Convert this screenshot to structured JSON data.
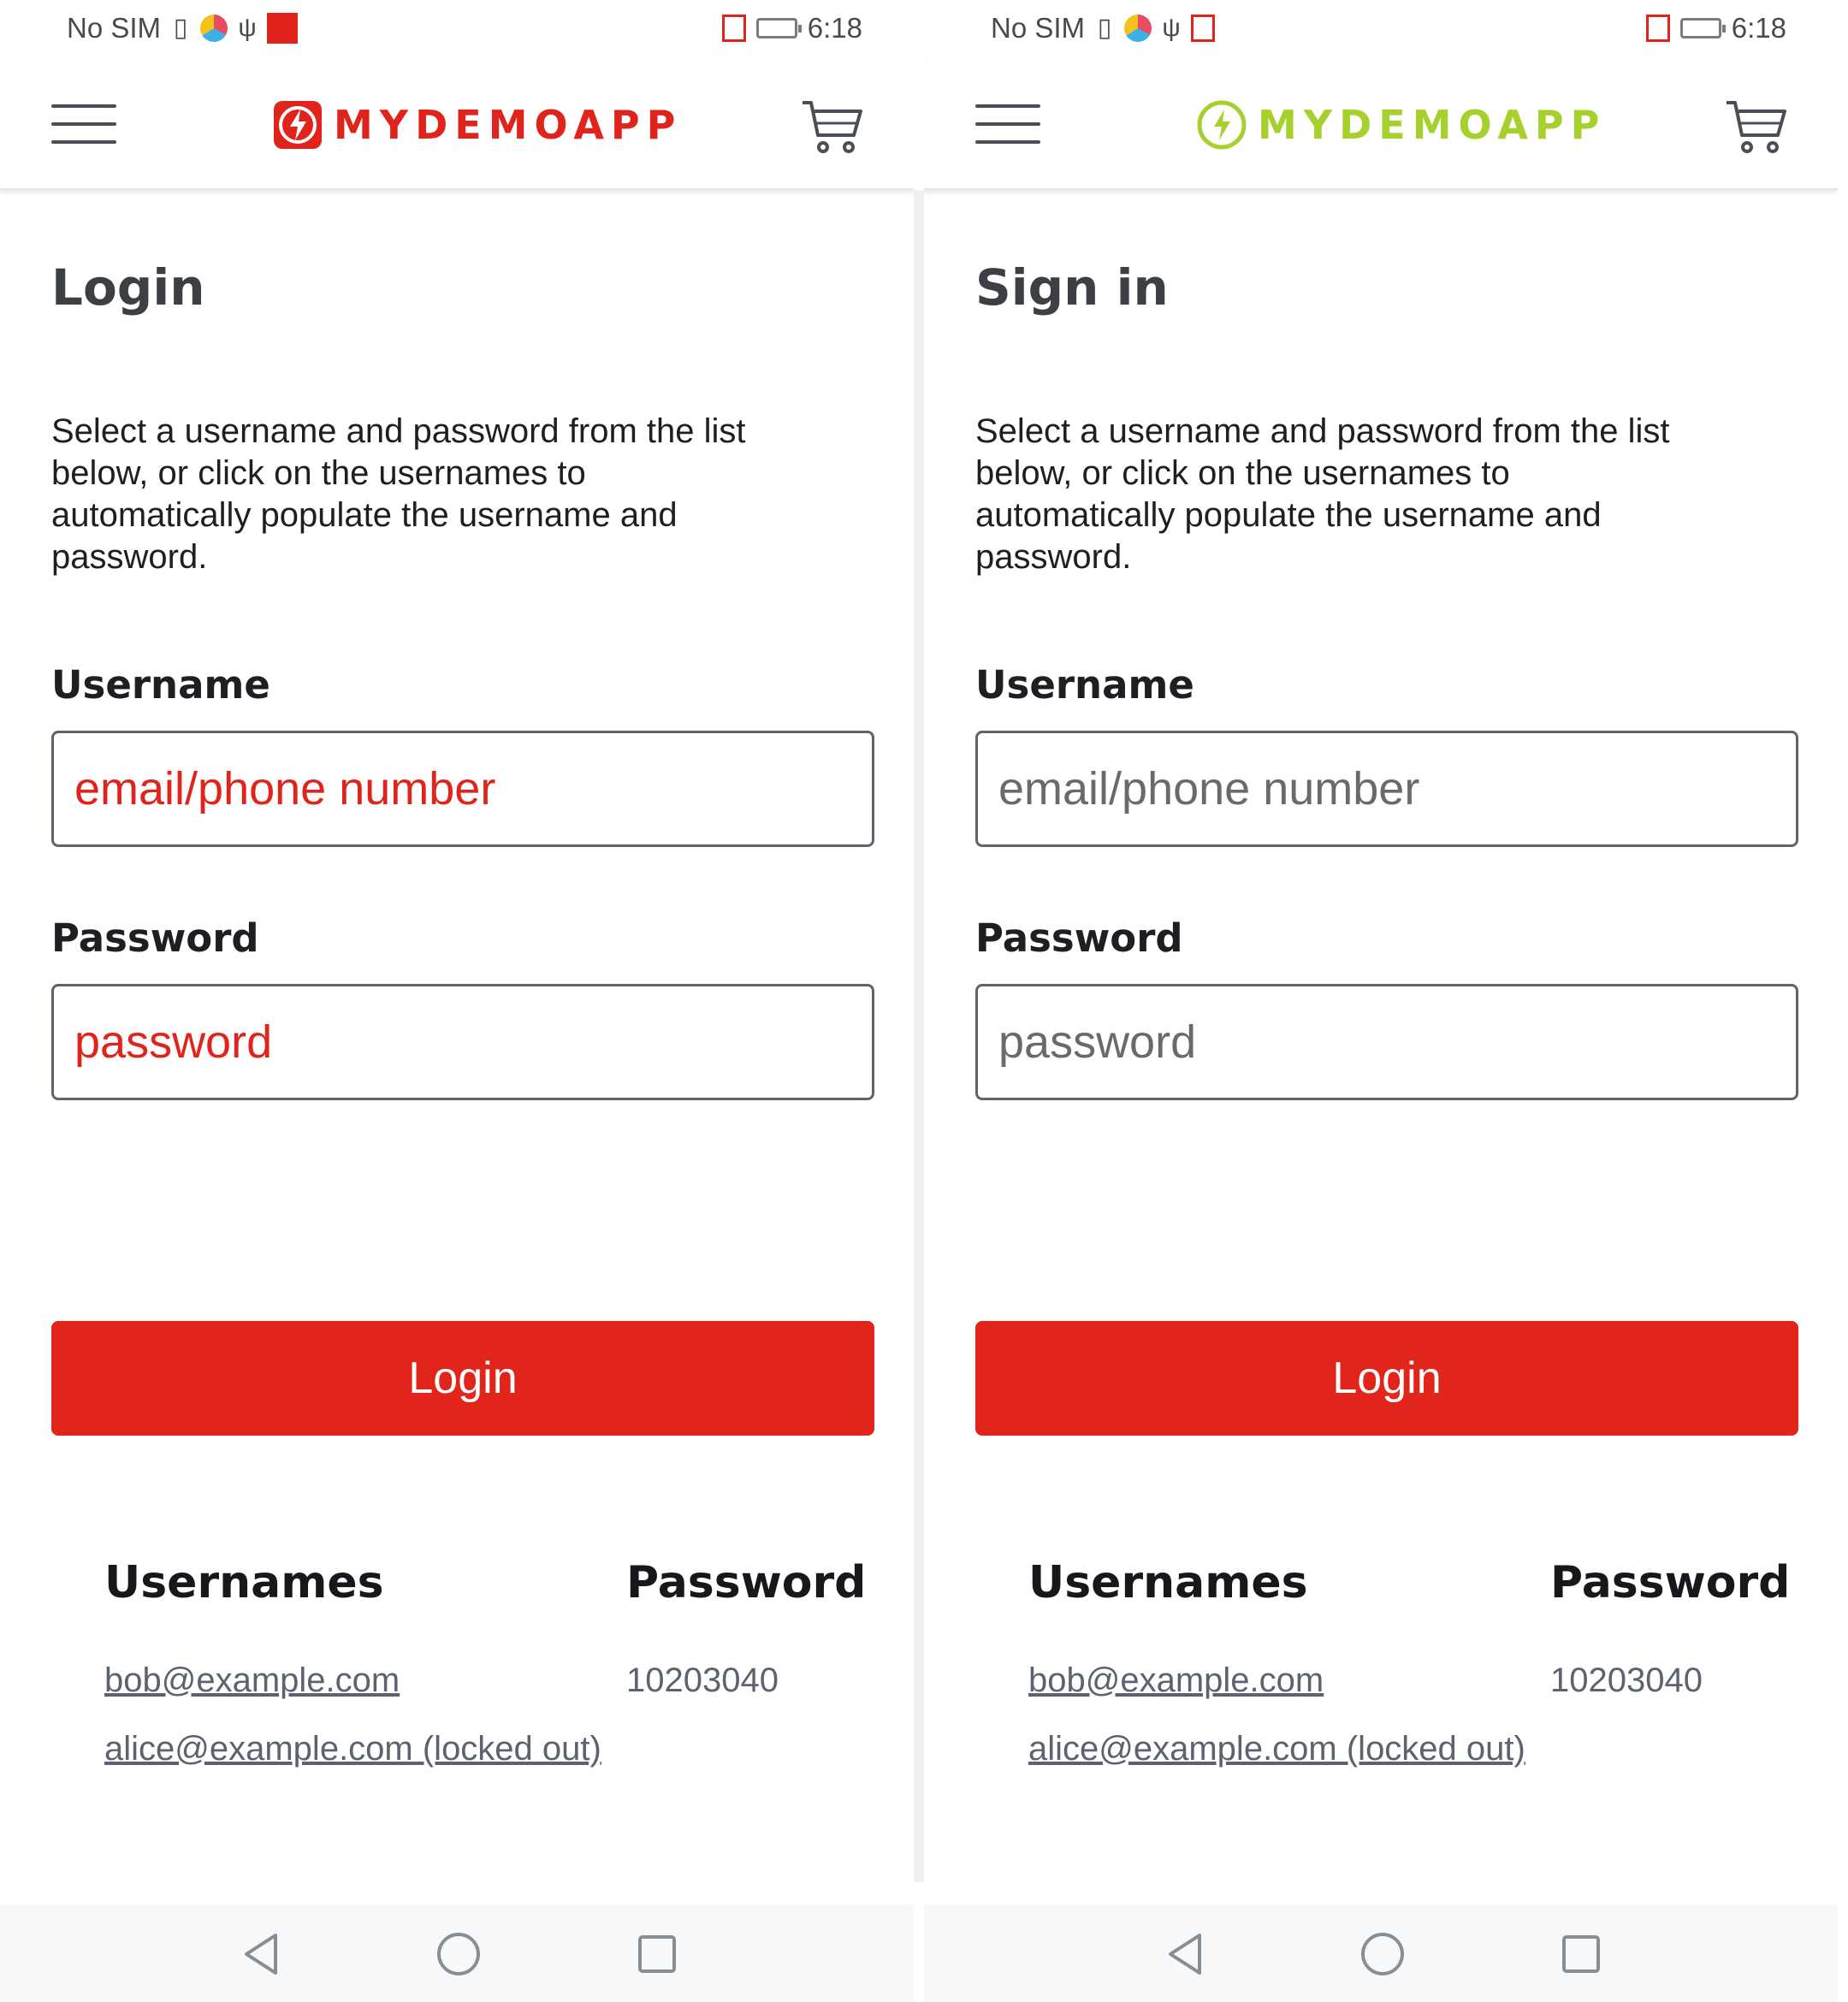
{
  "colors": {
    "accent": "#e2251b",
    "logo_left": "#e0241b",
    "logo_right": "#a6d12c",
    "text_dark": "#1d1f22",
    "link": "#5c6270"
  },
  "left": {
    "status": {
      "carrier": "No SIM",
      "time": "6:18",
      "icons": [
        "sim-card-icon",
        "color-circle-icon",
        "usb-icon",
        "huawei-app-icon",
        "alarm-icon",
        "battery-charging-icon"
      ]
    },
    "header": {
      "logo_text": "MYDEMOAPP",
      "menu_icon": "hamburger-menu-icon",
      "cart_icon": "cart-icon"
    },
    "title": "Login",
    "description": "Select a username and password from the list below, or click on the usernames to automatically populate the username and password.",
    "username_label": "Username",
    "username_placeholder": "email/phone number",
    "password_label": "Password",
    "password_placeholder": "password",
    "login_button": "Login",
    "creds": {
      "usernames_header": "Usernames",
      "password_header": "Password",
      "user1": "bob@example.com",
      "user2": "alice@example.com (locked out)",
      "password1": "10203040"
    }
  },
  "right": {
    "status": {
      "carrier": "No SIM",
      "time": "6:18",
      "icons": [
        "sim-card-icon",
        "color-circle-icon",
        "usb-icon",
        "notification-icon",
        "location-icon",
        "battery-charging-icon"
      ]
    },
    "header": {
      "logo_text": "MYDEMOAPP",
      "menu_icon": "hamburger-menu-icon",
      "cart_icon": "cart-icon"
    },
    "title": "Sign in",
    "description": "Select a username and password from the list below, or click on the usernames to automatically populate the username and password.",
    "username_label": "Username",
    "username_placeholder": "email/phone number",
    "password_label": "Password",
    "password_placeholder": "password",
    "login_button": "Login",
    "creds": {
      "usernames_header": "Usernames",
      "password_header": "Password",
      "user1": "bob@example.com",
      "user2": "alice@example.com (locked out)",
      "password1": "10203040"
    }
  }
}
